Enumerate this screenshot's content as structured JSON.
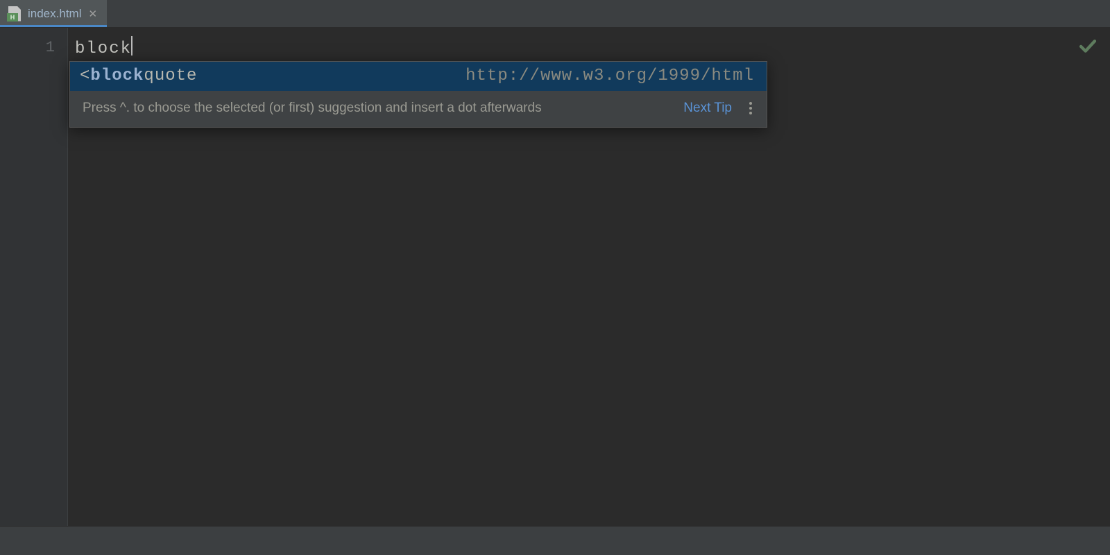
{
  "tab": {
    "filename": "index.html",
    "file_badge": "H"
  },
  "editor": {
    "line_number": "1",
    "typed_text": "block"
  },
  "autocomplete": {
    "suggestion": {
      "prefix": "<",
      "match": "block",
      "rest": "quote",
      "namespace": "http://www.w3.org/1999/html"
    },
    "hint": "Press ^. to choose the selected (or first) suggestion and insert a dot afterwards",
    "next_tip_label": "Next Tip"
  }
}
